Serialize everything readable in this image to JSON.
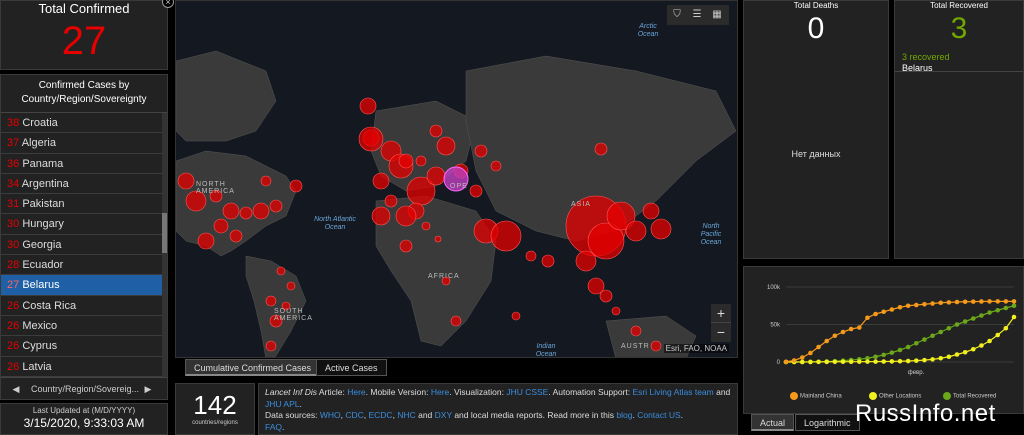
{
  "total_confirmed": {
    "label": "Total Confirmed",
    "value": "27"
  },
  "cases_list": {
    "title": "Confirmed Cases by Country/Region/Sovereignty",
    "items": [
      {
        "count": "38",
        "name": "Croatia"
      },
      {
        "count": "37",
        "name": "Algeria"
      },
      {
        "count": "36",
        "name": "Panama"
      },
      {
        "count": "34",
        "name": "Argentina"
      },
      {
        "count": "31",
        "name": "Pakistan"
      },
      {
        "count": "30",
        "name": "Hungary"
      },
      {
        "count": "30",
        "name": "Georgia"
      },
      {
        "count": "28",
        "name": "Ecuador"
      },
      {
        "count": "27",
        "name": "Belarus",
        "selected": true
      },
      {
        "count": "26",
        "name": "Costa Rica"
      },
      {
        "count": "26",
        "name": "Mexico"
      },
      {
        "count": "26",
        "name": "Cyprus"
      },
      {
        "count": "26",
        "name": "Latvia"
      }
    ],
    "footer_label": "Country/Region/Sovereig...",
    "prev_icon": "caret-left-icon",
    "next_icon": "caret-right-icon"
  },
  "last_updated": {
    "label": "Last Updated at (M/D/YYYY)",
    "value": "3/15/2020, 9:33:03 AM"
  },
  "map": {
    "ocean_labels": {
      "arctic": "Arctic Ocean",
      "north_atlantic": "North Atlantic Ocean",
      "north_pacific": "North Pacific Ocean",
      "indian": "Indian Ocean"
    },
    "land_labels": {
      "north_america": "NORTH AMERICA",
      "south_america": "SOUTH AMERICA",
      "africa": "AFRICA",
      "asia": "ASIA",
      "europe": "OPE",
      "australia": "AUSTR"
    },
    "attribution": "Esri, FAO, NOAA",
    "zoom_in": "+",
    "zoom_out": "−",
    "tools": [
      "bookmark-icon",
      "list-icon",
      "qr-code-icon"
    ],
    "tabs": [
      "Cumulative Confirmed Cases",
      "Active Cases"
    ]
  },
  "countries_count": {
    "value": "142",
    "label": "countries/regions"
  },
  "info": {
    "lead_italic": "Lancet Inf Dis",
    "t1": " Article: ",
    "here1": "Here",
    "t2": ". Mobile Version: ",
    "here2": "Here",
    "t3": ". Visualization: ",
    "jhu_csse": "JHU CSSE",
    "t4": ". Automation Support: ",
    "esri_team": "Esri Living Atlas team",
    "t5": " and ",
    "jhu_apl": "JHU APL",
    "t6": ".",
    "t7": "Data sources: ",
    "who": "WHO",
    "cdc": "CDC",
    "ecdc": "ECDC",
    "nhc": "NHC",
    "and": " and ",
    "dxy": "DXY",
    "t8": " and local media reports. Read more in this ",
    "blog": "blog",
    "t9": ". ",
    "contact": "Contact US",
    "faq": "FAQ",
    "comma": ", ",
    "dot": "."
  },
  "total_deaths": {
    "label": "Total Deaths",
    "value": "0",
    "no_data": "Нет данных"
  },
  "total_recovered": {
    "label": "Total Recovered",
    "value": "3",
    "detail_count": "3 recovered",
    "detail_country": "Belarus"
  },
  "chart_tabs": [
    "Actual",
    "Logarithmic"
  ],
  "watermark": "RussInfo.net",
  "colors": {
    "confirmed": "#e60000",
    "recovered": "#70a800",
    "selected": "#1e5fa5",
    "link": "#3a8dde"
  },
  "chart_data": {
    "type": "line",
    "x_ticks": [
      "февр."
    ],
    "y_ticks": [
      "0",
      "50k",
      "100k"
    ],
    "ylim": [
      0,
      100000
    ],
    "series": [
      {
        "name": "Mainland China",
        "color": "#f59a1a",
        "values": [
          300,
          2000,
          6000,
          12000,
          20000,
          28000,
          35000,
          40000,
          44000,
          46000,
          59000,
          64000,
          67000,
          70000,
          73000,
          75000,
          76000,
          77000,
          78000,
          79000,
          79500,
          80000,
          80300,
          80500,
          80700,
          80800,
          80800,
          80800,
          80800
        ]
      },
      {
        "name": "Other Locations",
        "color": "#f2ef1e",
        "values": [
          10,
          20,
          40,
          80,
          150,
          250,
          300,
          350,
          400,
          450,
          500,
          550,
          650,
          800,
          1000,
          1300,
          1800,
          2500,
          3500,
          5000,
          7000,
          10000,
          13000,
          17000,
          22000,
          28000,
          36000,
          45000,
          60000
        ]
      },
      {
        "name": "Total Recovered",
        "color": "#6aa819",
        "values": [
          0,
          30,
          80,
          150,
          300,
          600,
          1000,
          1800,
          2600,
          3600,
          5000,
          7000,
          9500,
          12500,
          16000,
          20000,
          25000,
          30000,
          35000,
          40000,
          45000,
          50000,
          54000,
          58000,
          62000,
          66000,
          69000,
          72000,
          75000
        ]
      }
    ]
  }
}
